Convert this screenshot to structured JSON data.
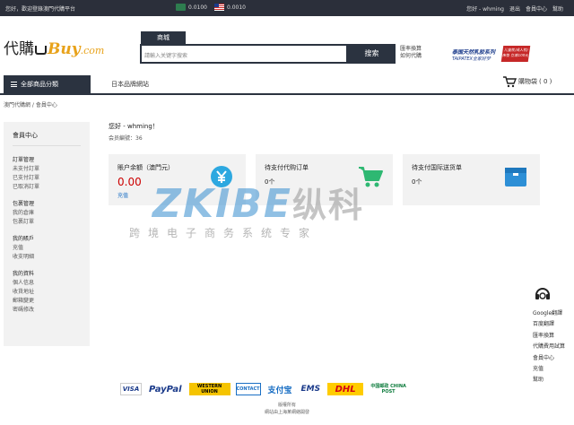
{
  "topbar": {
    "welcome": "您好，歡迎登錄澳門代購平台",
    "rate_mo": "0.0100",
    "rate_us": "0.0010",
    "user": "您好 - whming",
    "logout": "退出",
    "member_center": "會員中心",
    "help": "幫助"
  },
  "header": {
    "logo_cn": "代購",
    "logo_buy": "Buy",
    "logo_dom": ".com",
    "search_tab": "商城",
    "search_placeholder": "請輸入关键字搜索",
    "search_button": "搜索",
    "side_link_1": "匯率換算",
    "side_link_2": "如何代購",
    "banner_line1": "泰国天然乳胶系列",
    "banner_line2": "TAIPATEX全家好梦",
    "banner_badge": "儿童枕/成人枕/床垫 立减100元"
  },
  "nav": {
    "all_categories": "全部商品分類",
    "japan_sites": "日本品牌網站",
    "cart_label": "購物袋",
    "cart_count": "( 0 )"
  },
  "breadcrumb": "澳門代購網 / 會員中心",
  "sidebar": {
    "title": "會員中心",
    "groups": [
      {
        "heading": "訂單管理",
        "items": [
          "未支付訂單",
          "已支付訂單",
          "已取消訂單"
        ]
      },
      {
        "heading": "包裹管理",
        "items": [
          "我的倉庫",
          "包裹訂單"
        ]
      },
      {
        "heading": "我的賬戶",
        "items": [
          "充值",
          "收支明細"
        ]
      },
      {
        "heading": "我的資料",
        "items": [
          "個人信息",
          "收貨地址",
          "郵箱變更",
          "密碼修改"
        ]
      }
    ]
  },
  "member": {
    "greeting": "您好 - whming！",
    "member_no": "会员編號：36"
  },
  "cards": [
    {
      "title": "賬户余額（澳門元）",
      "value": "0.00",
      "link": "充值"
    },
    {
      "title": "待支付代购订单",
      "value": "0个"
    },
    {
      "title": "待支付国际送货单",
      "value": "0个"
    }
  ],
  "watermark": {
    "main": "ZKIBE",
    "cn": "纵科",
    "sub": "跨境电子商务系统专家"
  },
  "right_links": [
    "Google翻譯",
    "百度翻譯",
    "匯率換算",
    "代購費用試算",
    "會員中心",
    "充值",
    "幫助"
  ],
  "payments": [
    "VISA",
    "PayPal",
    "WESTERN UNION",
    "CONTACT",
    "支付宝",
    "EMS",
    "DHL",
    "中国邮政 CHINA POST"
  ],
  "footer": {
    "copyright": "版權所有",
    "line2": "網站由上海某網絡開發"
  },
  "colors": {
    "dark": "#2b3340",
    "accent": "#2da8e0",
    "green": "#2eb872",
    "red": "#c00000"
  }
}
